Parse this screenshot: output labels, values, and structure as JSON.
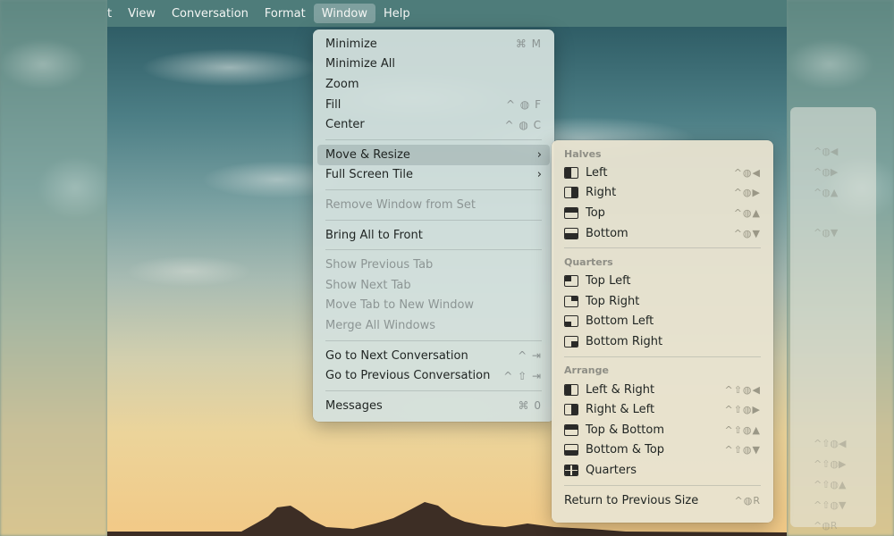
{
  "menubar": {
    "items": [
      {
        "label": "t",
        "active": false
      },
      {
        "label": "View",
        "active": false
      },
      {
        "label": "Conversation",
        "active": false
      },
      {
        "label": "Format",
        "active": false
      },
      {
        "label": "Window",
        "active": true
      },
      {
        "label": "Help",
        "active": false
      }
    ]
  },
  "window_menu": {
    "minimize": {
      "label": "Minimize",
      "shortcut": "⌘ M"
    },
    "minimize_all": {
      "label": "Minimize All"
    },
    "zoom": {
      "label": "Zoom"
    },
    "fill": {
      "label": "Fill",
      "shortcut": "^ ◍ F"
    },
    "center": {
      "label": "Center",
      "shortcut": "^ ◍ C"
    },
    "move_resize": {
      "label": "Move & Resize",
      "chevron": "›"
    },
    "full_screen_tile": {
      "label": "Full Screen Tile",
      "chevron": "›"
    },
    "remove_window": {
      "label": "Remove Window from Set"
    },
    "bring_all": {
      "label": "Bring All to Front"
    },
    "show_prev_tab": {
      "label": "Show Previous Tab"
    },
    "show_next_tab": {
      "label": "Show Next Tab"
    },
    "move_tab": {
      "label": "Move Tab to New Window"
    },
    "merge_windows": {
      "label": "Merge All Windows"
    },
    "next_conv": {
      "label": "Go to Next Conversation",
      "shortcut": "^ ⇥"
    },
    "prev_conv": {
      "label": "Go to Previous Conversation",
      "shortcut": "^ ⇧ ⇥"
    },
    "messages": {
      "label": "Messages",
      "shortcut": "⌘ 0"
    }
  },
  "submenu": {
    "halves_header": "Halves",
    "left": {
      "label": "Left",
      "shortcut": "^◍◀"
    },
    "right": {
      "label": "Right",
      "shortcut": "^◍▶"
    },
    "top": {
      "label": "Top",
      "shortcut": "^◍▲"
    },
    "bottom": {
      "label": "Bottom",
      "shortcut": "^◍▼"
    },
    "quarters_header": "Quarters",
    "top_left": {
      "label": "Top Left"
    },
    "top_right": {
      "label": "Top Right"
    },
    "bottom_left": {
      "label": "Bottom Left"
    },
    "bottom_right": {
      "label": "Bottom Right"
    },
    "arrange_header": "Arrange",
    "left_right": {
      "label": "Left & Right",
      "shortcut": "^⇧◍◀"
    },
    "right_left": {
      "label": "Right & Left",
      "shortcut": "^⇧◍▶"
    },
    "top_bottom": {
      "label": "Top & Bottom",
      "shortcut": "^⇧◍▲"
    },
    "bottom_top": {
      "label": "Bottom & Top",
      "shortcut": "^⇧◍▼"
    },
    "quarters": {
      "label": "Quarters"
    },
    "return_prev": {
      "label": "Return to Previous Size",
      "shortcut": "^◍R"
    }
  },
  "side_ghost": {
    "r1": "^◍◀",
    "r2": "^◍▶",
    "r3": "^◍▲",
    "r4": "^◍▼",
    "r5": "^⇧◍◀",
    "r6": "^⇧◍▶",
    "r7": "^⇧◍▲",
    "r8": "^⇧◍▼",
    "r9": "^◍R"
  },
  "colors": {
    "menubar": "#4e7c7a",
    "menu_bg": "#d4e1de",
    "submenu_bg": "#e8e3d0",
    "highlight": "#9fb0ae",
    "disabled_text": "#8c9594"
  }
}
